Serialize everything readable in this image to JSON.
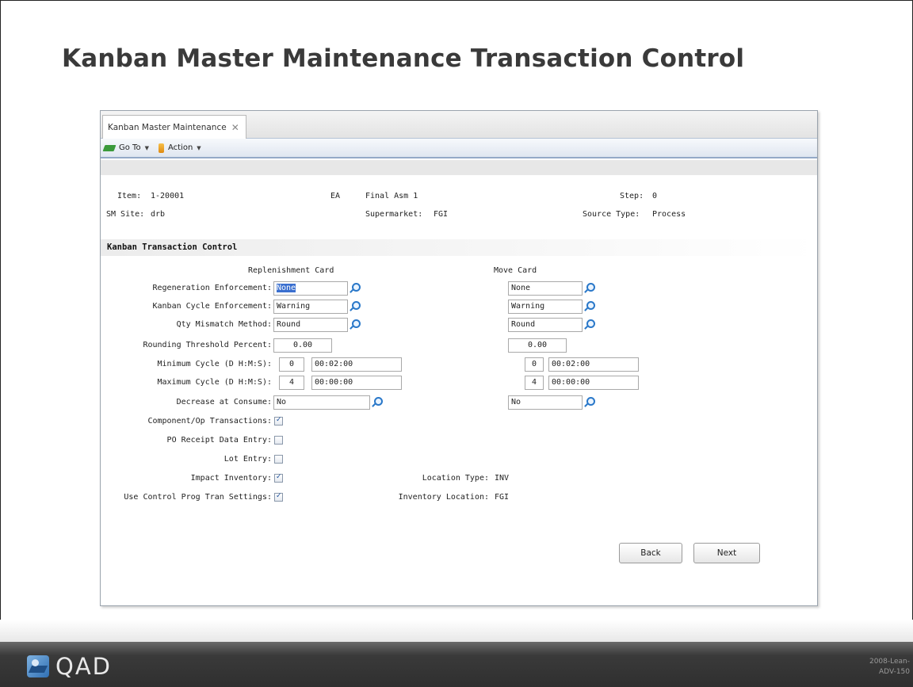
{
  "slide": {
    "title": "Kanban Master Maintenance Transaction Control",
    "footer_code_line1": "2008-Lean-",
    "footer_code_line2": "ADV-150",
    "logo_text": "QAD"
  },
  "tab": {
    "label": "Kanban Master Maintenance",
    "close": "✕"
  },
  "toolbar": {
    "goto_label": "Go To",
    "action_label": "Action",
    "caret": "▼"
  },
  "header": {
    "item_label": "Item:",
    "item_value": "1-20001",
    "um_value": "EA",
    "description": "Final Asm 1",
    "step_label": "Step:",
    "step_value": "0",
    "site_label": "SM Site:",
    "site_value": "drb",
    "supermarket_label": "Supermarket:",
    "supermarket_value": "FGI",
    "source_type_label": "Source Type:",
    "source_type_value": "Process"
  },
  "section": {
    "title": "Kanban Transaction Control",
    "col_replenishment": "Replenishment Card",
    "col_move": "Move Card"
  },
  "rows": {
    "regen": {
      "label": "Regeneration Enforcement:",
      "rep": "None",
      "move": "None"
    },
    "cycle": {
      "label": "Kanban Cycle Enforcement:",
      "rep": "Warning",
      "move": "Warning"
    },
    "qty": {
      "label": "Qty Mismatch Method:",
      "rep": "Round",
      "move": "Round"
    },
    "rounding": {
      "label": "Rounding Threshold Percent:",
      "rep": "0.00",
      "move": "0.00"
    },
    "min_cycle": {
      "label": "Minimum Cycle (D H:M:S):",
      "rep_days": "0",
      "rep_time": "00:02:00",
      "move_days": "0",
      "move_time": "00:02:00"
    },
    "max_cycle": {
      "label": "Maximum Cycle (D H:M:S):",
      "rep_days": "4",
      "rep_time": "00:00:00",
      "move_days": "4",
      "move_time": "00:00:00"
    },
    "decrease": {
      "label": "Decrease at Consume:",
      "rep": "No",
      "move": "No"
    }
  },
  "checks": {
    "component_label": "Component/Op Transactions:",
    "component_checked": true,
    "po_receipt_label": "PO Receipt Data Entry:",
    "po_receipt_checked": false,
    "lot_entry_label": "Lot Entry:",
    "lot_entry_checked": false,
    "impact_label": "Impact Inventory:",
    "impact_checked": true,
    "use_control_label": "Use Control Prog Tran Settings:",
    "use_control_checked": true
  },
  "location": {
    "type_label": "Location Type:",
    "type_value": "INV",
    "inv_label": "Inventory Location:",
    "inv_value": "FGI"
  },
  "buttons": {
    "back": "Back",
    "next": "Next"
  }
}
